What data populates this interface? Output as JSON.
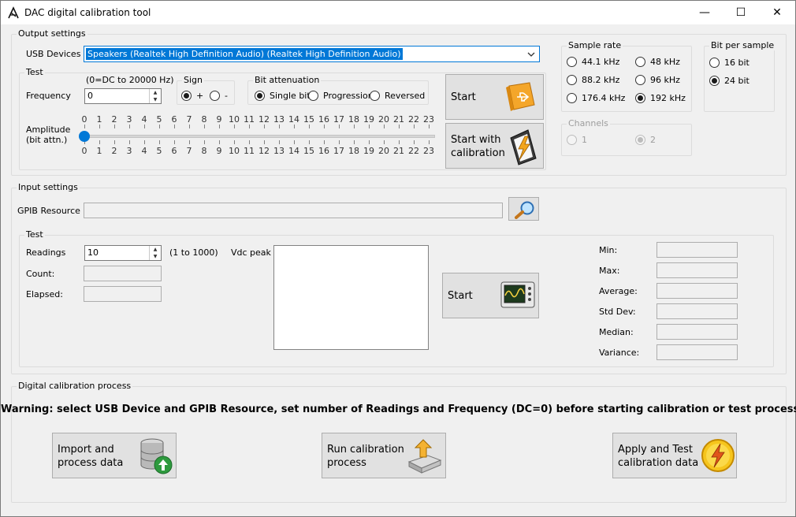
{
  "window": {
    "title": "DAC digital calibration tool",
    "min_glyph": "—",
    "max_glyph": "☐",
    "close_glyph": "✕"
  },
  "output": {
    "group_label": "Output settings",
    "usb_label": "USB Devices",
    "usb_value": "Speakers (Realtek High Definition Audio) (Realtek High Definition Audio)",
    "test": {
      "group_label": "Test",
      "freq_hint": "(0=DC to 20000 Hz)",
      "freq_label": "Frequency",
      "freq_value": "0",
      "sign_label": "Sign",
      "sign_plus": "+",
      "sign_minus": "-",
      "atten_label": "Bit attenuation",
      "atten_single": "Single bit",
      "atten_progression": "Progression",
      "atten_reversed": "Reversed",
      "amp_label_1": "Amplitude",
      "amp_label_2": "(bit attn.)",
      "slider_ticks": [
        "0",
        "1",
        "2",
        "3",
        "4",
        "5",
        "6",
        "7",
        "8",
        "9",
        "10",
        "11",
        "12",
        "13",
        "14",
        "15",
        "16",
        "17",
        "18",
        "19",
        "20",
        "21",
        "22",
        "23"
      ],
      "slider_value": 0,
      "start_label": "Start",
      "start_cal_line1": "Start with",
      "start_cal_line2": "calibration"
    },
    "sample_rate": {
      "group_label": "Sample rate",
      "options": [
        "44.1 kHz",
        "48 kHz",
        "88.2 kHz",
        "96 kHz",
        "176.4 kHz",
        "192 kHz"
      ],
      "selected": "192 kHz"
    },
    "bits": {
      "group_label": "Bit per sample",
      "options": [
        "16 bit",
        "24 bit"
      ],
      "selected": "24 bit"
    },
    "channels": {
      "group_label": "Channels",
      "options": [
        "1",
        "2"
      ],
      "selected": "2"
    }
  },
  "input": {
    "group_label": "Input settings",
    "gpib_label": "GPIB Resource",
    "gpib_value": "",
    "test": {
      "group_label": "Test",
      "readings_label": "Readings",
      "readings_value": "10",
      "readings_hint": "(1 to 1000)",
      "count_label": "Count:",
      "elapsed_label": "Elapsed:",
      "vdc_label": "Vdc peak",
      "start_label": "Start",
      "stats": [
        "Min:",
        "Max:",
        "Average:",
        "Std Dev:",
        "Median:",
        "Variance:"
      ]
    }
  },
  "calibration": {
    "group_label": "Digital calibration process",
    "warning": "Warning: select USB Device and GPIB Resource, set number of Readings and Frequency (DC=0) before starting calibration or test process",
    "import_line1": "Import and",
    "import_line2": "process data",
    "run_line1": "Run calibration",
    "run_line2": "process",
    "apply_line1": "Apply and Test",
    "apply_line2": "calibration data"
  },
  "colors": {
    "accent": "#0078d7",
    "selection": "#0078d7",
    "usb_orange": "#f29b1d",
    "bolt_yellow": "#f6c51d",
    "db_green": "#2e9a3e"
  }
}
